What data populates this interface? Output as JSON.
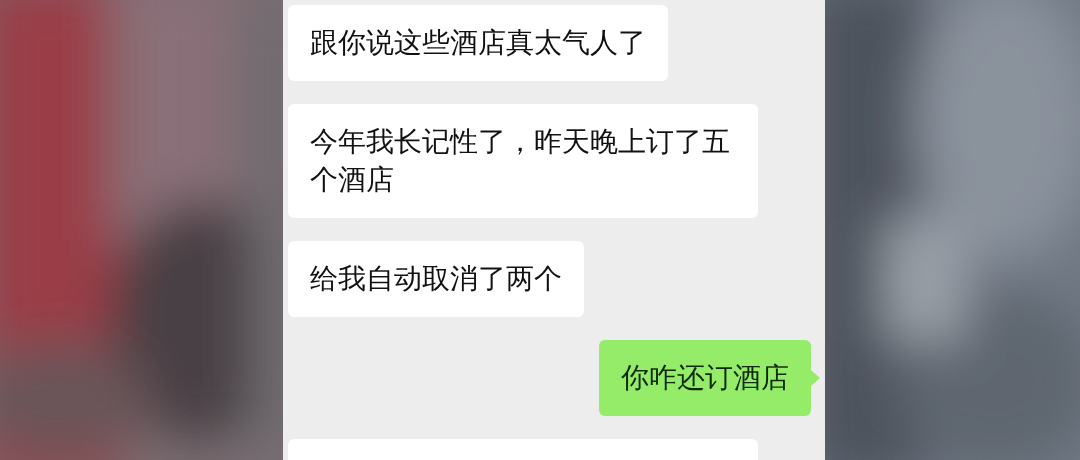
{
  "messages": [
    {
      "kind": "incoming",
      "text": "跟你说这些酒店真太气人了"
    },
    {
      "kind": "incoming",
      "text": "今年我长记性了，昨天晚上订了五个酒店"
    },
    {
      "kind": "incoming",
      "text": "给我自动取消了两个"
    },
    {
      "kind": "outgoing",
      "text": "你咋还订酒店"
    },
    {
      "kind": "incoming"
    }
  ]
}
